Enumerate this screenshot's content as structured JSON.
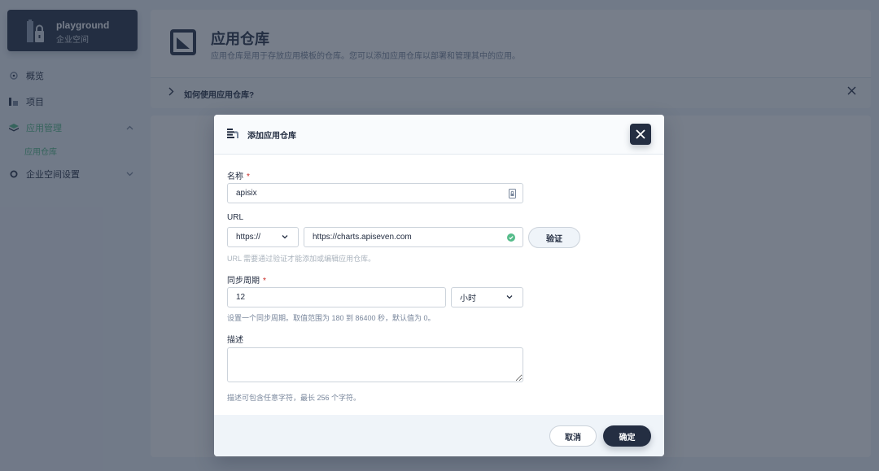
{
  "workspace": {
    "name": "playground",
    "type_label": "企业空间"
  },
  "sidebar": {
    "items": [
      {
        "label": "概览",
        "icon": "dashboard-icon"
      },
      {
        "label": "项目",
        "icon": "project-icon"
      },
      {
        "label": "应用管理",
        "icon": "app-management-icon",
        "expanded": true,
        "active": true
      },
      {
        "label": "企业空间设置",
        "icon": "settings-icon",
        "expanded": false
      }
    ],
    "sub_items": [
      {
        "label": "应用仓库",
        "active": true
      }
    ]
  },
  "page": {
    "title": "应用仓库",
    "description": "应用仓库是用于存放应用模板的仓库。您可以添加应用仓库以部署和管理其中的应用。",
    "help_title": "如何使用应用仓库?"
  },
  "modal": {
    "title": "添加应用仓库",
    "fields": {
      "name": {
        "label": "名称",
        "required": true,
        "value": "apisix"
      },
      "url": {
        "label": "URL",
        "protocol": "https://",
        "value": "https://charts.apiseven.com",
        "validated": true,
        "verify_label": "验证",
        "hint": "URL 需要通过验证才能添加或编辑应用仓库。"
      },
      "sync_period": {
        "label": "同步周期",
        "required": true,
        "value": "12",
        "unit": "小时",
        "hint": "设置一个同步周期。取值范围为 180 到 86400 秒，默认值为 0。"
      },
      "description": {
        "label": "描述",
        "value": "",
        "hint": "描述可包含任意字符，最长 256 个字符。"
      }
    },
    "buttons": {
      "cancel": "取消",
      "ok": "确定"
    }
  },
  "colors": {
    "primary_dark": "#242e42",
    "success_green": "#55bc8a",
    "required_red": "#ca2621",
    "overlay": "rgba(36,46,66,0.62)"
  }
}
